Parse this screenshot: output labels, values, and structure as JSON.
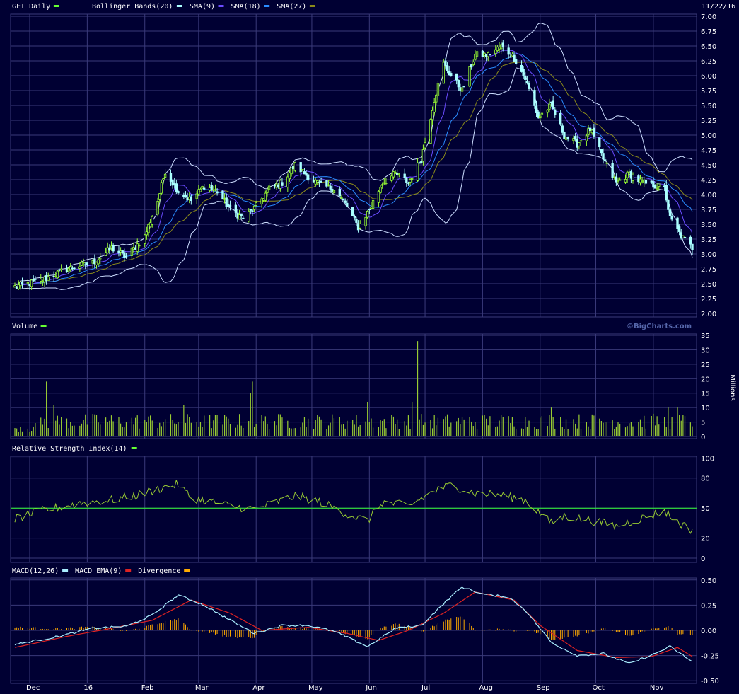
{
  "header": {
    "date": "11/22/16",
    "watermark": "©BigCharts.com"
  },
  "colors": {
    "background": "#000033",
    "grid": "#3a3a7a",
    "up_candle": "#99ff33",
    "down_candle": "#aaffff",
    "bollinger": "#ccddff",
    "sma9": "#6a4cff",
    "sma18": "#2a8cff",
    "sma27": "#8a8a1a",
    "volume": "#99cc33",
    "rsi": "#99cc33",
    "rsi_midline": "#33ff33",
    "macd": "#aaeeff",
    "macd_ema": "#dd2222",
    "divergence": "#ffaa00"
  },
  "chart_data": [
    {
      "type": "candlestick",
      "panel": "price",
      "legend": [
        {
          "label": "GFI Daily",
          "color": "#66ff33"
        },
        {
          "label": "Bollinger Bands(20)",
          "color": "#aaffff"
        },
        {
          "label": "SMA(9)",
          "color": "#6a4cff"
        },
        {
          "label": "SMA(18)",
          "color": "#2a8cff"
        },
        {
          "label": "SMA(27)",
          "color": "#8a8a1a"
        }
      ],
      "ylim": [
        2.0,
        7.0
      ],
      "yticks": [
        "7.00",
        "6.75",
        "6.50",
        "6.25",
        "6.00",
        "5.75",
        "5.50",
        "5.25",
        "5.00",
        "4.75",
        "4.50",
        "4.25",
        "4.00",
        "3.75",
        "3.50",
        "3.25",
        "3.00",
        "2.75",
        "2.50",
        "2.25",
        "2.00"
      ],
      "close_anchors": [
        {
          "date": "2015-11-23",
          "value": 2.45
        },
        {
          "date": "2015-12-07",
          "value": 2.55
        },
        {
          "date": "2015-12-21",
          "value": 2.75
        },
        {
          "date": "2016-01-04",
          "value": 2.85
        },
        {
          "date": "2016-01-14",
          "value": 3.1
        },
        {
          "date": "2016-01-22",
          "value": 2.95
        },
        {
          "date": "2016-02-01",
          "value": 3.3
        },
        {
          "date": "2016-02-08",
          "value": 3.9
        },
        {
          "date": "2016-02-12",
          "value": 4.4
        },
        {
          "date": "2016-02-19",
          "value": 4.05
        },
        {
          "date": "2016-02-26",
          "value": 3.9
        },
        {
          "date": "2016-03-04",
          "value": 4.15
        },
        {
          "date": "2016-03-11",
          "value": 4.05
        },
        {
          "date": "2016-03-18",
          "value": 3.75
        },
        {
          "date": "2016-03-25",
          "value": 3.6
        },
        {
          "date": "2016-04-01",
          "value": 3.8
        },
        {
          "date": "2016-04-08",
          "value": 4.1
        },
        {
          "date": "2016-04-15",
          "value": 4.2
        },
        {
          "date": "2016-04-22",
          "value": 4.5
        },
        {
          "date": "2016-04-29",
          "value": 4.3
        },
        {
          "date": "2016-05-06",
          "value": 4.15
        },
        {
          "date": "2016-05-13",
          "value": 4.1
        },
        {
          "date": "2016-05-20",
          "value": 3.8
        },
        {
          "date": "2016-05-26",
          "value": 3.45
        },
        {
          "date": "2016-06-01",
          "value": 3.75
        },
        {
          "date": "2016-06-08",
          "value": 4.2
        },
        {
          "date": "2016-06-15",
          "value": 4.35
        },
        {
          "date": "2016-06-22",
          "value": 4.2
        },
        {
          "date": "2016-06-29",
          "value": 4.6
        },
        {
          "date": "2016-07-06",
          "value": 5.6
        },
        {
          "date": "2016-07-11",
          "value": 6.2
        },
        {
          "date": "2016-07-15",
          "value": 6.0
        },
        {
          "date": "2016-07-21",
          "value": 5.75
        },
        {
          "date": "2016-07-28",
          "value": 6.35
        },
        {
          "date": "2016-08-04",
          "value": 6.35
        },
        {
          "date": "2016-08-11",
          "value": 6.5
        },
        {
          "date": "2016-08-18",
          "value": 6.3
        },
        {
          "date": "2016-08-24",
          "value": 5.95
        },
        {
          "date": "2016-08-31",
          "value": 5.3
        },
        {
          "date": "2016-09-07",
          "value": 5.5
        },
        {
          "date": "2016-09-14",
          "value": 5.0
        },
        {
          "date": "2016-09-21",
          "value": 4.85
        },
        {
          "date": "2016-09-28",
          "value": 5.1
        },
        {
          "date": "2016-10-05",
          "value": 4.6
        },
        {
          "date": "2016-10-12",
          "value": 4.2
        },
        {
          "date": "2016-10-19",
          "value": 4.35
        },
        {
          "date": "2016-10-26",
          "value": 4.2
        },
        {
          "date": "2016-11-02",
          "value": 4.15
        },
        {
          "date": "2016-11-07",
          "value": 4.1
        },
        {
          "date": "2016-11-10",
          "value": 3.6
        },
        {
          "date": "2016-11-16",
          "value": 3.3
        },
        {
          "date": "2016-11-22",
          "value": 3.1
        }
      ],
      "xlim": [
        "2015-11-23",
        "2016-11-22"
      ],
      "x_ticks": [
        {
          "label": "Dec",
          "date": "2015-12-01"
        },
        {
          "label": "16",
          "date": "2016-01-01"
        },
        {
          "label": "Feb",
          "date": "2016-02-01"
        },
        {
          "label": "Mar",
          "date": "2016-03-01"
        },
        {
          "label": "Apr",
          "date": "2016-04-01"
        },
        {
          "label": "May",
          "date": "2016-05-01"
        },
        {
          "label": "Jun",
          "date": "2016-06-01"
        },
        {
          "label": "Jul",
          "date": "2016-07-01"
        },
        {
          "label": "Aug",
          "date": "2016-08-01"
        },
        {
          "label": "Sep",
          "date": "2016-09-01"
        },
        {
          "label": "Oct",
          "date": "2016-10-01"
        },
        {
          "label": "Nov",
          "date": "2016-11-01"
        }
      ]
    },
    {
      "type": "bar",
      "panel": "volume",
      "legend": [
        {
          "label": "Volume",
          "color": "#66ff33"
        }
      ],
      "ylabel": "Millions",
      "ylim": [
        0,
        35
      ],
      "yticks": [
        "35",
        "30",
        "25",
        "20",
        "15",
        "10",
        "5",
        "0"
      ],
      "typical_volume": 5.5,
      "spikes": [
        {
          "date": "2015-12-10",
          "value": 19
        },
        {
          "date": "2015-12-14",
          "value": 11
        },
        {
          "date": "2016-02-22",
          "value": 11
        },
        {
          "date": "2016-03-29",
          "value": 15
        },
        {
          "date": "2016-03-30",
          "value": 19
        },
        {
          "date": "2016-05-31",
          "value": 12
        },
        {
          "date": "2016-06-24",
          "value": 12
        },
        {
          "date": "2016-06-27",
          "value": 33
        },
        {
          "date": "2016-09-07",
          "value": 10
        },
        {
          "date": "2016-11-09",
          "value": 10
        },
        {
          "date": "2016-11-14",
          "value": 10
        }
      ]
    },
    {
      "type": "line",
      "panel": "rsi",
      "legend": [
        {
          "label": "Relative Strength Index(14)",
          "color": "#66ff33"
        }
      ],
      "ylim": [
        0,
        100
      ],
      "yticks": [
        "100",
        "80",
        "50",
        "20",
        "0"
      ],
      "midline": 50,
      "anchors": [
        {
          "date": "2015-11-23",
          "value": 39
        },
        {
          "date": "2015-12-07",
          "value": 47
        },
        {
          "date": "2015-12-28",
          "value": 55
        },
        {
          "date": "2016-01-14",
          "value": 58
        },
        {
          "date": "2016-01-28",
          "value": 63
        },
        {
          "date": "2016-02-10",
          "value": 70
        },
        {
          "date": "2016-02-19",
          "value": 74
        },
        {
          "date": "2016-02-26",
          "value": 60
        },
        {
          "date": "2016-03-04",
          "value": 58
        },
        {
          "date": "2016-03-18",
          "value": 52
        },
        {
          "date": "2016-03-31",
          "value": 49
        },
        {
          "date": "2016-04-12",
          "value": 56
        },
        {
          "date": "2016-04-22",
          "value": 62
        },
        {
          "date": "2016-05-06",
          "value": 56
        },
        {
          "date": "2016-05-20",
          "value": 44
        },
        {
          "date": "2016-05-31",
          "value": 37
        },
        {
          "date": "2016-06-08",
          "value": 56
        },
        {
          "date": "2016-06-22",
          "value": 52
        },
        {
          "date": "2016-07-06",
          "value": 67
        },
        {
          "date": "2016-07-15",
          "value": 73
        },
        {
          "date": "2016-07-28",
          "value": 65
        },
        {
          "date": "2016-08-11",
          "value": 63
        },
        {
          "date": "2016-08-24",
          "value": 58
        },
        {
          "date": "2016-09-07",
          "value": 35
        },
        {
          "date": "2016-09-14",
          "value": 42
        },
        {
          "date": "2016-09-28",
          "value": 38
        },
        {
          "date": "2016-10-12",
          "value": 32
        },
        {
          "date": "2016-10-26",
          "value": 40
        },
        {
          "date": "2016-11-07",
          "value": 47
        },
        {
          "date": "2016-11-14",
          "value": 36
        },
        {
          "date": "2016-11-22",
          "value": 28
        }
      ]
    },
    {
      "type": "line",
      "panel": "macd",
      "legend": [
        {
          "label": "MACD(12,26)",
          "color": "#aaeeff"
        },
        {
          "label": "MACD EMA(9)",
          "color": "#dd2222"
        },
        {
          "label": "Divergence",
          "color": "#ffaa00"
        }
      ],
      "ylim": [
        -0.5,
        0.5
      ],
      "yticks": [
        "0.50",
        "0.25",
        "0.00",
        "-0.25",
        "-0.50"
      ],
      "macd_anchors": [
        {
          "date": "2015-11-23",
          "value": -0.14
        },
        {
          "date": "2015-12-14",
          "value": -0.07
        },
        {
          "date": "2016-01-04",
          "value": 0.02
        },
        {
          "date": "2016-01-22",
          "value": 0.04
        },
        {
          "date": "2016-02-05",
          "value": 0.15
        },
        {
          "date": "2016-02-19",
          "value": 0.35
        },
        {
          "date": "2016-03-04",
          "value": 0.25
        },
        {
          "date": "2016-03-18",
          "value": 0.1
        },
        {
          "date": "2016-03-31",
          "value": -0.03
        },
        {
          "date": "2016-04-15",
          "value": 0.05
        },
        {
          "date": "2016-04-29",
          "value": 0.05
        },
        {
          "date": "2016-05-13",
          "value": -0.01
        },
        {
          "date": "2016-05-31",
          "value": -0.16
        },
        {
          "date": "2016-06-15",
          "value": 0.02
        },
        {
          "date": "2016-06-29",
          "value": 0.05
        },
        {
          "date": "2016-07-13",
          "value": 0.3
        },
        {
          "date": "2016-07-21",
          "value": 0.43
        },
        {
          "date": "2016-08-01",
          "value": 0.36
        },
        {
          "date": "2016-08-15",
          "value": 0.33
        },
        {
          "date": "2016-08-24",
          "value": 0.2
        },
        {
          "date": "2016-09-07",
          "value": -0.12
        },
        {
          "date": "2016-09-21",
          "value": -0.25
        },
        {
          "date": "2016-10-05",
          "value": -0.23
        },
        {
          "date": "2016-10-19",
          "value": -0.33
        },
        {
          "date": "2016-11-02",
          "value": -0.23
        },
        {
          "date": "2016-11-10",
          "value": -0.16
        },
        {
          "date": "2016-11-22",
          "value": -0.31
        }
      ],
      "ema_anchors": [
        {
          "date": "2015-11-23",
          "value": -0.17
        },
        {
          "date": "2015-12-21",
          "value": -0.06
        },
        {
          "date": "2016-01-14",
          "value": 0.02
        },
        {
          "date": "2016-02-05",
          "value": 0.1
        },
        {
          "date": "2016-02-26",
          "value": 0.3
        },
        {
          "date": "2016-03-18",
          "value": 0.17
        },
        {
          "date": "2016-04-04",
          "value": 0.0
        },
        {
          "date": "2016-04-29",
          "value": 0.03
        },
        {
          "date": "2016-05-20",
          "value": -0.03
        },
        {
          "date": "2016-06-06",
          "value": -0.1
        },
        {
          "date": "2016-06-22",
          "value": 0.0
        },
        {
          "date": "2016-07-11",
          "value": 0.17
        },
        {
          "date": "2016-07-28",
          "value": 0.38
        },
        {
          "date": "2016-08-18",
          "value": 0.3
        },
        {
          "date": "2016-09-01",
          "value": 0.05
        },
        {
          "date": "2016-09-21",
          "value": -0.2
        },
        {
          "date": "2016-10-12",
          "value": -0.27
        },
        {
          "date": "2016-10-31",
          "value": -0.26
        },
        {
          "date": "2016-11-14",
          "value": -0.17
        },
        {
          "date": "2016-11-22",
          "value": -0.26
        }
      ]
    }
  ]
}
